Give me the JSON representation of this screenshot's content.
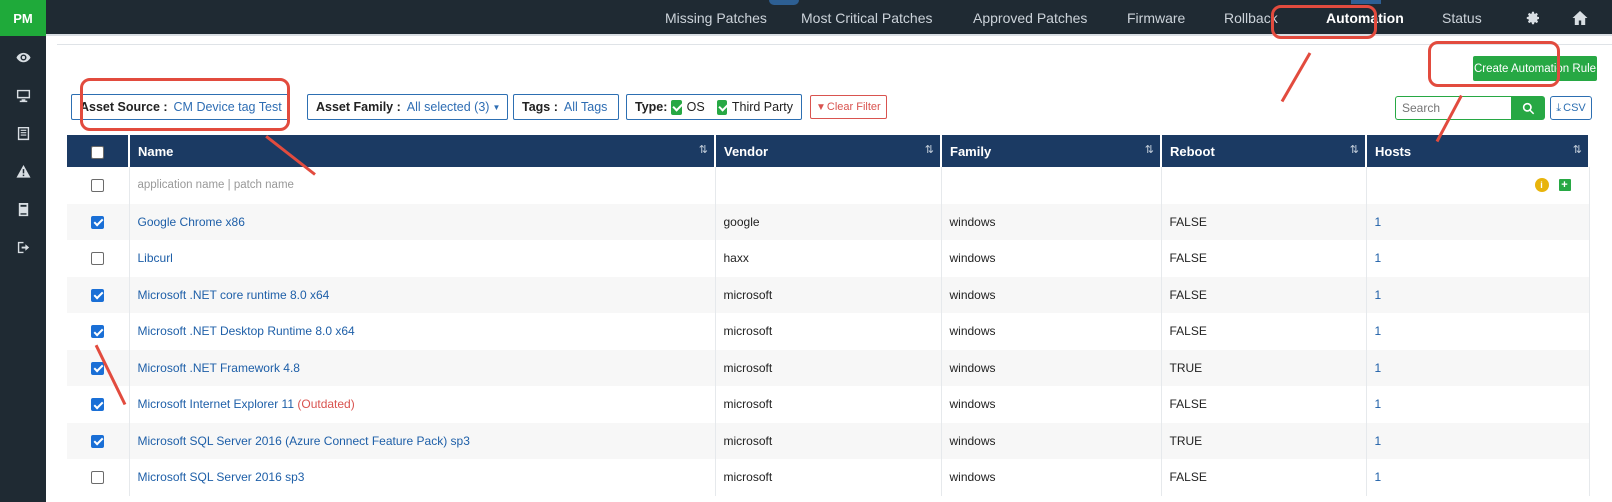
{
  "brand": "PM",
  "nav": [
    {
      "label": "Missing Patches"
    },
    {
      "label": "Most Critical Patches"
    },
    {
      "label": "Approved Patches"
    },
    {
      "label": "Firmware"
    },
    {
      "label": "Rollback"
    },
    {
      "label": "Automation",
      "active": true
    },
    {
      "label": "Status"
    }
  ],
  "toolbar": {
    "create_label": "Create Automation Rule",
    "search_placeholder": "Search",
    "csv_label": "CSV",
    "clear_label": "Clear Filter"
  },
  "filters": {
    "asset_source_label": "Asset Source :",
    "asset_source_value": "CM Device tag Test",
    "asset_family_label": "Asset Family :",
    "asset_family_value": "All selected (3)",
    "tags_label": "Tags :",
    "tags_value": "All Tags",
    "type_label": "Type:",
    "type_os": "OS",
    "type_third_party": "Third Party"
  },
  "table": {
    "headers": [
      "Name",
      "Vendor",
      "Family",
      "Reboot",
      "Hosts"
    ],
    "name_placeholder": "application name | patch name",
    "rows": [
      {
        "checked": true,
        "name": "Google Chrome x86",
        "tag": "",
        "vendor": "google",
        "family": "windows",
        "reboot": "FALSE",
        "hosts": "1"
      },
      {
        "checked": false,
        "name": "Libcurl",
        "tag": "",
        "vendor": "haxx",
        "family": "windows",
        "reboot": "FALSE",
        "hosts": "1"
      },
      {
        "checked": true,
        "name": "Microsoft .NET core runtime 8.0 x64",
        "tag": "",
        "vendor": "microsoft",
        "family": "windows",
        "reboot": "FALSE",
        "hosts": "1"
      },
      {
        "checked": true,
        "name": "Microsoft .NET Desktop Runtime 8.0 x64",
        "tag": "",
        "vendor": "microsoft",
        "family": "windows",
        "reboot": "FALSE",
        "hosts": "1"
      },
      {
        "checked": true,
        "name": "Microsoft .NET Framework 4.8",
        "tag": "",
        "vendor": "microsoft",
        "family": "windows",
        "reboot": "TRUE",
        "hosts": "1"
      },
      {
        "checked": true,
        "name": "Microsoft Internet Explorer 11",
        "tag": "(Outdated)",
        "vendor": "microsoft",
        "family": "windows",
        "reboot": "FALSE",
        "hosts": "1"
      },
      {
        "checked": true,
        "name": "Microsoft SQL Server 2016 (Azure Connect Feature Pack) sp3",
        "tag": "",
        "vendor": "microsoft",
        "family": "windows",
        "reboot": "TRUE",
        "hosts": "1"
      },
      {
        "checked": false,
        "name": "Microsoft SQL Server 2016 sp3",
        "tag": "",
        "vendor": "microsoft",
        "family": "windows",
        "reboot": "FALSE",
        "hosts": "1"
      }
    ]
  },
  "colors": {
    "sidebar_bg": "#1f2a33",
    "header_bg": "#1b3a63",
    "accent_green": "#27a844",
    "link_blue": "#1e5fa8",
    "annotation_red": "#e24b3e"
  },
  "icons": {
    "sidebar": [
      "eye-icon",
      "monitor-icon",
      "list-icon",
      "warning-icon",
      "book-icon",
      "logout-icon"
    ],
    "nav": [
      "gear-icon",
      "home-icon"
    ]
  }
}
